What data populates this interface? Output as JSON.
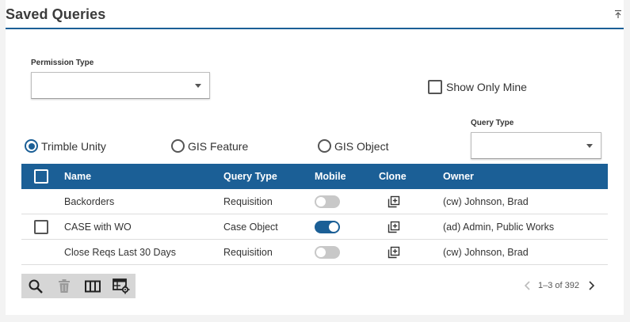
{
  "header": {
    "title": "Saved Queries"
  },
  "filters": {
    "permission_type_label": "Permission Type",
    "permission_type_value": "",
    "show_only_mine_label": "Show Only Mine",
    "show_only_mine_checked": false,
    "query_type_label": "Query Type",
    "query_type_value": ""
  },
  "source_tabs": {
    "selected": "Trimble Unity",
    "options": [
      "Trimble Unity",
      "GIS Feature",
      "GIS Object"
    ]
  },
  "grid": {
    "columns": [
      "Name",
      "Query Type",
      "Mobile",
      "Clone",
      "Owner"
    ],
    "rows": [
      {
        "name": "Backorders",
        "query_type": "Requisition",
        "mobile": false,
        "owner": "(cw) Johnson, Brad",
        "row_checkbox_visible": false
      },
      {
        "name": "CASE with WO",
        "query_type": "Case Object",
        "mobile": true,
        "owner": "(ad) Admin, Public Works",
        "row_checkbox_visible": true
      },
      {
        "name": "Close Reqs Last 30 Days",
        "query_type": "Requisition",
        "mobile": false,
        "owner": "(cw) Johnson, Brad",
        "row_checkbox_visible": false
      }
    ]
  },
  "toolbar": {
    "icons": [
      "search-icon",
      "delete-icon",
      "columns-icon",
      "grid-settings-icon"
    ]
  },
  "pagination": {
    "text": "1–3 of 392"
  },
  "colors": {
    "primary": "#1b5f96",
    "toolbar_bg": "#d6d6d6",
    "toggle_off": "#c8c8c8"
  }
}
